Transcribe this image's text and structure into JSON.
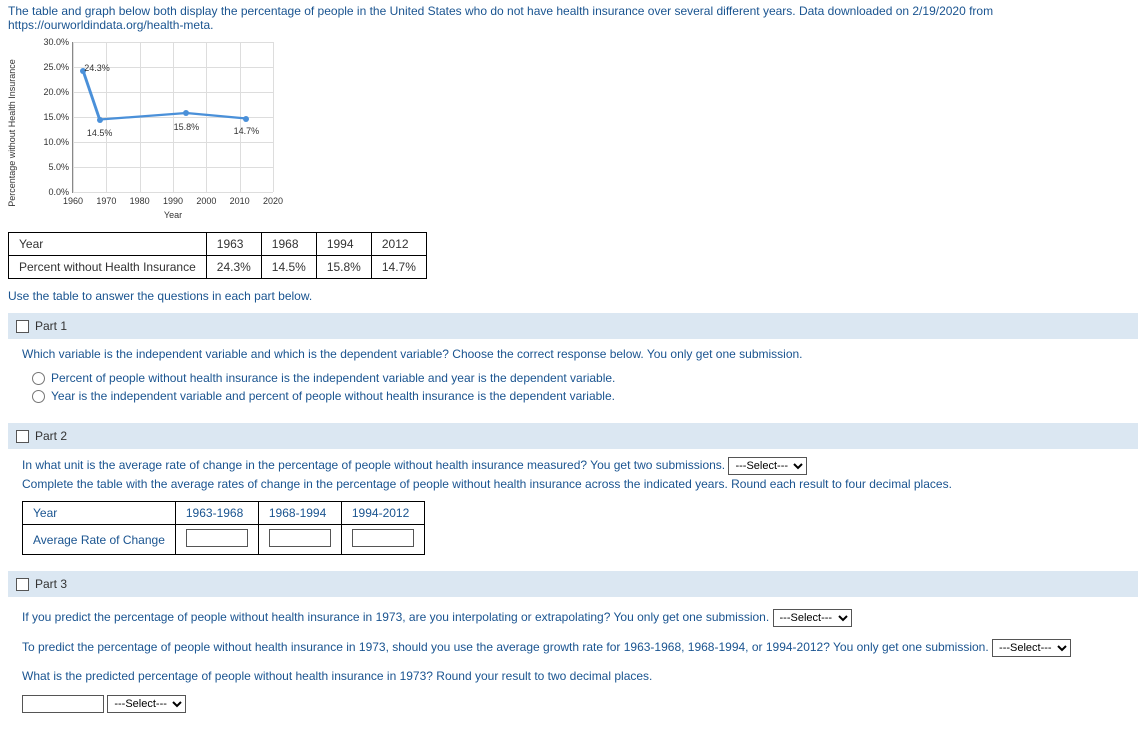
{
  "intro": "The table and graph below both display the percentage of people in the United States who do not have health insurance over several different years. Data downloaded on 2/19/2020 from https://ourworldindata.org/health-meta.",
  "chart_data": {
    "type": "line",
    "x": [
      1963,
      1968,
      1994,
      2012
    ],
    "values": [
      24.3,
      14.5,
      15.8,
      14.7
    ],
    "point_labels": [
      "24.3%",
      "14.5%",
      "15.8%",
      "14.7%"
    ],
    "title": "",
    "xlabel": "Year",
    "ylabel": "Percentage without Health Insurance",
    "xlim": [
      1960,
      2020
    ],
    "ylim": [
      0,
      30
    ],
    "y_ticks": [
      "0.0%",
      "5.0%",
      "10.0%",
      "15.0%",
      "20.0%",
      "25.0%",
      "30.0%"
    ],
    "x_ticks": [
      "1960",
      "1970",
      "1980",
      "1990",
      "2000",
      "2010",
      "2020"
    ]
  },
  "table": {
    "row1_label": "Year",
    "years": [
      "1963",
      "1968",
      "1994",
      "2012"
    ],
    "row2_label": "Percent without Health Insurance",
    "values": [
      "24.3%",
      "14.5%",
      "15.8%",
      "14.7%"
    ]
  },
  "instruction": "Use the table to answer the questions in each part below.",
  "part1": {
    "header": "Part 1",
    "prompt": "Which variable is the independent variable and which is the dependent variable? Choose the correct response below. You only get one submission.",
    "opt_a": "Percent of people without health insurance is the independent variable and year is the dependent variable.",
    "opt_b": "Year is the independent variable and percent of people without health insurance is the dependent variable."
  },
  "part2": {
    "header": "Part 2",
    "line1a": "In what unit is the average rate of change in the percentage of people without health insurance measured? You get two submissions.",
    "line2": "Complete the table with the average rates of change in the percentage of people without health insurance across the indicated years. Round each result to four decimal places.",
    "table": {
      "row1_label": "Year",
      "cols": [
        "1963-1968",
        "1968-1994",
        "1994-2012"
      ],
      "row2_label": "Average Rate of Change"
    },
    "select_placeholder": "---Select---"
  },
  "part3": {
    "header": "Part 3",
    "q1": "If you predict the percentage of people without health insurance in 1973, are you interpolating or extrapolating? You only get one submission.",
    "q2": "To predict the percentage of people without health insurance in 1973, should you use the average growth rate for 1963-1968, 1968-1994, or 1994-2012? You only get one submission.",
    "q3": "What is the predicted percentage of people without health insurance in 1973? Round your result to two decimal places.",
    "select_placeholder": "---Select---"
  }
}
